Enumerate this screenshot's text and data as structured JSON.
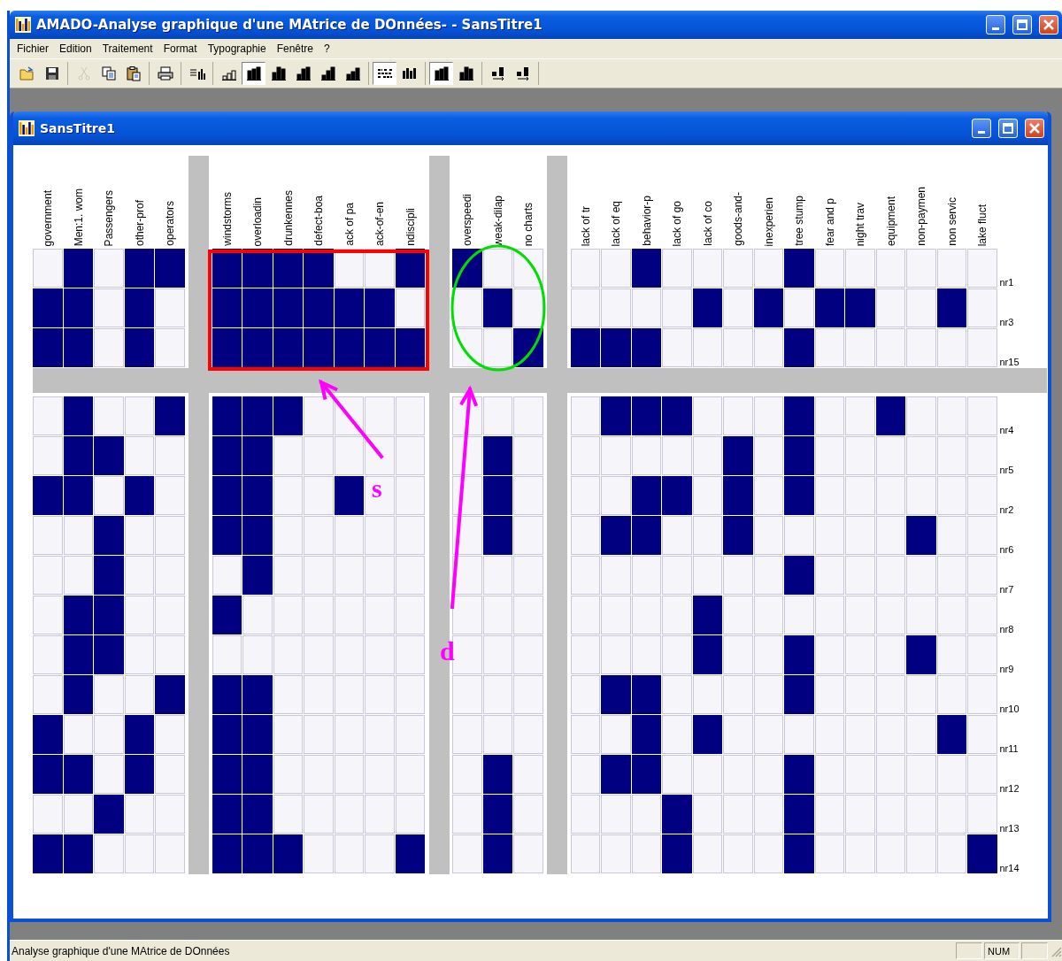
{
  "window": {
    "title": "AMADO-Analyse graphique d'une MAtrice de DOnnées- - SansTitre1"
  },
  "menu": [
    "Fichier",
    "Edition",
    "Traitement",
    "Format",
    "Typographie",
    "Fenêtre",
    "?"
  ],
  "toolbar": [
    [
      {
        "kind": "open",
        "pressed": false,
        "disabled": false
      },
      {
        "kind": "save",
        "pressed": false,
        "disabled": false
      }
    ],
    [
      {
        "kind": "cut",
        "pressed": false,
        "disabled": true
      },
      {
        "kind": "copy",
        "pressed": false,
        "disabled": false
      },
      {
        "kind": "paste",
        "pressed": false,
        "disabled": false
      }
    ],
    [
      {
        "kind": "print",
        "pressed": false,
        "disabled": false
      }
    ],
    [
      {
        "kind": "sort",
        "pressed": false,
        "disabled": false
      }
    ],
    [
      {
        "kind": "bars",
        "pressed": false,
        "disabled": false
      },
      {
        "kind": "bars",
        "pressed": true,
        "disabled": false
      },
      {
        "kind": "bars",
        "pressed": false,
        "disabled": false
      },
      {
        "kind": "bars",
        "pressed": false,
        "disabled": false
      },
      {
        "kind": "bars",
        "pressed": false,
        "disabled": false
      },
      {
        "kind": "bars",
        "pressed": false,
        "disabled": false
      }
    ],
    [
      {
        "kind": "rows",
        "pressed": true,
        "disabled": false
      },
      {
        "kind": "grid",
        "pressed": false,
        "disabled": false
      }
    ],
    [
      {
        "kind": "bars",
        "pressed": true,
        "disabled": false
      },
      {
        "kind": "bars",
        "pressed": false,
        "disabled": false
      }
    ],
    [
      {
        "kind": "swap",
        "pressed": false,
        "disabled": false
      },
      {
        "kind": "swap",
        "pressed": false,
        "disabled": false
      }
    ]
  ],
  "document": {
    "title": "SansTitre1",
    "column_groups": [
      [
        "government",
        "Men:1. wom",
        "Passengers",
        "other-prof",
        "operators"
      ],
      [
        "windstorms",
        "overloadin",
        "drunkennes",
        "defect-boa",
        "ack of pa",
        "ack-of-en",
        "ndiscipli"
      ],
      [
        "overspeedi",
        "weak-dilap",
        "no charts"
      ],
      [
        "lack of tr",
        "lack of eq",
        "behavior-p",
        "lack of go",
        "lack of co",
        "goods-and-",
        "inexperien",
        "tree stump",
        "fear and p",
        "night trav",
        "equipment",
        "non-paymen",
        "non servic",
        "lake fluct"
      ]
    ],
    "row_groups": [
      [
        {
          "label": "nr1",
          "cells": [
            [
              false,
              true,
              false,
              true,
              true
            ],
            [
              true,
              true,
              true,
              true,
              false,
              false,
              true
            ],
            [
              true,
              false,
              false
            ],
            [
              false,
              false,
              true,
              false,
              false,
              false,
              false,
              true,
              false,
              false,
              false,
              false,
              false,
              false
            ]
          ]
        },
        {
          "label": "nr3",
          "cells": [
            [
              true,
              true,
              false,
              true,
              false
            ],
            [
              true,
              true,
              true,
              true,
              true,
              true,
              false
            ],
            [
              false,
              true,
              false
            ],
            [
              false,
              false,
              false,
              false,
              true,
              false,
              true,
              false,
              true,
              true,
              false,
              false,
              true,
              false
            ]
          ]
        },
        {
          "label": "nr15",
          "cells": [
            [
              true,
              true,
              false,
              true,
              false
            ],
            [
              true,
              true,
              true,
              true,
              true,
              true,
              true
            ],
            [
              false,
              false,
              true
            ],
            [
              true,
              true,
              true,
              false,
              false,
              false,
              false,
              true,
              false,
              false,
              false,
              false,
              false,
              false
            ]
          ]
        }
      ],
      [
        {
          "label": "nr4",
          "cells": [
            [
              false,
              true,
              false,
              false,
              true
            ],
            [
              true,
              true,
              true,
              false,
              false,
              false,
              false
            ],
            [
              false,
              false,
              false
            ],
            [
              false,
              true,
              true,
              true,
              false,
              false,
              false,
              true,
              false,
              false,
              true,
              false,
              false,
              false
            ]
          ]
        },
        {
          "label": "nr5",
          "cells": [
            [
              false,
              true,
              true,
              false,
              false
            ],
            [
              true,
              true,
              false,
              false,
              false,
              false,
              false
            ],
            [
              false,
              true,
              false
            ],
            [
              false,
              false,
              false,
              false,
              false,
              true,
              false,
              true,
              false,
              false,
              false,
              false,
              false,
              false
            ]
          ]
        },
        {
          "label": "nr2",
          "cells": [
            [
              true,
              true,
              false,
              true,
              false
            ],
            [
              true,
              true,
              false,
              false,
              true,
              false,
              false
            ],
            [
              false,
              true,
              false
            ],
            [
              false,
              false,
              true,
              true,
              false,
              true,
              false,
              true,
              false,
              false,
              false,
              false,
              false,
              false
            ]
          ]
        },
        {
          "label": "nr6",
          "cells": [
            [
              false,
              false,
              true,
              false,
              false
            ],
            [
              true,
              true,
              false,
              false,
              false,
              false,
              false
            ],
            [
              false,
              true,
              false
            ],
            [
              false,
              true,
              true,
              false,
              false,
              true,
              false,
              false,
              false,
              false,
              false,
              true,
              false,
              false
            ]
          ]
        },
        {
          "label": "nr7",
          "cells": [
            [
              false,
              false,
              true,
              false,
              false
            ],
            [
              false,
              true,
              false,
              false,
              false,
              false,
              false
            ],
            [
              false,
              false,
              false
            ],
            [
              false,
              false,
              false,
              false,
              false,
              false,
              false,
              true,
              false,
              false,
              false,
              false,
              false,
              false
            ]
          ]
        },
        {
          "label": "nr8",
          "cells": [
            [
              false,
              true,
              true,
              false,
              false
            ],
            [
              true,
              false,
              false,
              false,
              false,
              false,
              false
            ],
            [
              false,
              false,
              false
            ],
            [
              false,
              false,
              false,
              false,
              true,
              false,
              false,
              false,
              false,
              false,
              false,
              false,
              false,
              false
            ]
          ]
        },
        {
          "label": "nr9",
          "cells": [
            [
              false,
              true,
              true,
              false,
              false
            ],
            [
              false,
              false,
              false,
              false,
              false,
              false,
              false
            ],
            [
              false,
              false,
              false
            ],
            [
              false,
              false,
              false,
              false,
              true,
              false,
              false,
              true,
              false,
              false,
              false,
              true,
              false,
              false
            ]
          ]
        },
        {
          "label": "nr10",
          "cells": [
            [
              false,
              true,
              false,
              false,
              true
            ],
            [
              true,
              true,
              false,
              false,
              false,
              false,
              false
            ],
            [
              false,
              false,
              false
            ],
            [
              false,
              true,
              true,
              false,
              false,
              false,
              false,
              true,
              false,
              false,
              false,
              false,
              false,
              false
            ]
          ]
        },
        {
          "label": "nr11",
          "cells": [
            [
              true,
              false,
              false,
              true,
              false
            ],
            [
              true,
              true,
              false,
              false,
              false,
              false,
              false
            ],
            [
              false,
              false,
              false
            ],
            [
              false,
              false,
              true,
              false,
              true,
              false,
              false,
              false,
              false,
              false,
              false,
              false,
              true,
              false
            ]
          ]
        },
        {
          "label": "nr12",
          "cells": [
            [
              true,
              true,
              false,
              true,
              false
            ],
            [
              true,
              true,
              false,
              false,
              false,
              false,
              false
            ],
            [
              false,
              true,
              false
            ],
            [
              false,
              true,
              true,
              false,
              false,
              false,
              false,
              true,
              false,
              false,
              false,
              false,
              false,
              false
            ]
          ]
        },
        {
          "label": "nr13",
          "cells": [
            [
              false,
              false,
              true,
              false,
              false
            ],
            [
              true,
              true,
              false,
              false,
              false,
              false,
              false
            ],
            [
              false,
              true,
              false
            ],
            [
              false,
              false,
              false,
              true,
              false,
              false,
              false,
              true,
              false,
              false,
              false,
              false,
              false,
              false
            ]
          ]
        },
        {
          "label": "nr14",
          "cells": [
            [
              true,
              true,
              false,
              false,
              false
            ],
            [
              true,
              true,
              true,
              false,
              false,
              false,
              true
            ],
            [
              false,
              true,
              false
            ],
            [
              false,
              false,
              false,
              true,
              false,
              false,
              false,
              true,
              false,
              false,
              false,
              false,
              false,
              true
            ]
          ]
        }
      ]
    ],
    "annotations": [
      {
        "kind": "rectangle",
        "color": "#ff0000"
      },
      {
        "kind": "ellipse",
        "color": "#00dd00"
      },
      {
        "kind": "arrow",
        "color": "#ff00ff",
        "label": "s"
      },
      {
        "kind": "arrow",
        "color": "#ff00ff",
        "label": "d"
      }
    ]
  },
  "status_bar": {
    "text": "Analyse graphique d'une MAtrice de DOnnées",
    "indicator": "NUM"
  }
}
